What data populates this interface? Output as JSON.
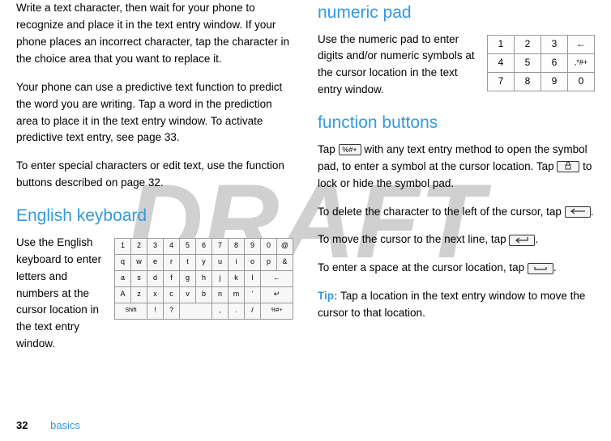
{
  "watermark": "DRAFT",
  "leftColumn": {
    "para1": "Write a text character, then wait for your phone to recognize and place it in the text entry window. If your phone places an incorrect character, tap the character in the choice area that you want to replace it.",
    "para2": "Your phone can use a predictive text function to predict the word you are writing. Tap a word in the prediction area to place it in the text entry window. To activate predictive text entry, see page 33.",
    "para3": "To enter special characters or edit text, use the function buttons described on page 32.",
    "heading1": "English keyboard",
    "para4": "Use the English keyboard to enter letters and numbers at the cursor location in the text entry window."
  },
  "rightColumn": {
    "heading1": "numeric pad",
    "para1": "Use the numeric pad to enter digits and/or numeric symbols at the cursor location in the text entry window.",
    "heading2": "function buttons",
    "para2a": "Tap ",
    "para2b": " with any text entry method to open the symbol pad, to enter a symbol at the cursor location. Tap ",
    "para2c": " to lock or hide the symbol pad.",
    "para3a": "To delete the character to the left of the cursor, tap ",
    "para3b": ".",
    "para4a": "To move the cursor to the next line, tap ",
    "para4b": ".",
    "para5a": "To enter a space at the cursor location, tap ",
    "para5b": ".",
    "tipLabel": "Tip:",
    "para6": " Tap a location in the text entry window to move the cursor to that location."
  },
  "keycaps": {
    "symbolPad": "%#+",
    "lock": "lock-icon",
    "backspace": "backspace-icon",
    "enter": "enter-icon",
    "space": "space-icon"
  },
  "keyboardIllustration": {
    "rows": [
      [
        "1",
        "2",
        "3",
        "4",
        "5",
        "6",
        "7",
        "8",
        "9",
        "0",
        "@"
      ],
      [
        "q",
        "w",
        "e",
        "r",
        "t",
        "y",
        "u",
        "i",
        "o",
        "p",
        "&"
      ],
      [
        "a",
        "s",
        "d",
        "f",
        "g",
        "h",
        "j",
        "k",
        "l",
        "",
        ""
      ],
      [
        "",
        "z",
        "x",
        "c",
        "v",
        "b",
        "n",
        "m",
        "'",
        "",
        ""
      ],
      [
        "",
        "!",
        "?",
        "",
        "",
        "",
        ",",
        ".",
        "/",
        "",
        ""
      ]
    ],
    "shiftLabel": "Shift",
    "capsLabel": "A",
    "backArrow": "←",
    "enterArrow": "↵",
    "symKey": "%#+"
  },
  "numpadIllustration": {
    "rows": [
      [
        "1",
        "2",
        "3",
        "←"
      ],
      [
        "4",
        "5",
        "6",
        ",*#+"
      ],
      [
        "7",
        "8",
        "9",
        "0"
      ]
    ]
  },
  "footer": {
    "pageNumber": "32",
    "sectionName": "basics"
  }
}
